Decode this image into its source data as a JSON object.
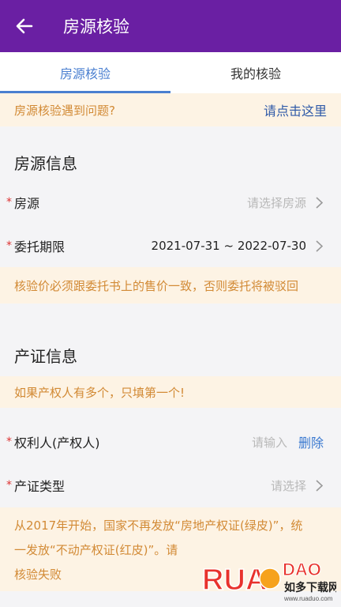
{
  "header": {
    "title": "房源核验",
    "back_icon": "arrow-left-icon"
  },
  "tabs": [
    {
      "label": "房源核验",
      "active": true
    },
    {
      "label": "我的核验",
      "active": false
    }
  ],
  "help_notice": {
    "text": "房源核验遇到问题?",
    "link": "请点击这里"
  },
  "house_section": {
    "title": "房源信息",
    "house": {
      "required": "*",
      "label": "房源",
      "placeholder": "请选择房源"
    },
    "term": {
      "required": "*",
      "label": "委托期限",
      "value": "2021-07-31 ~ 2022-07-30"
    },
    "warning": "核验价必须跟委托书上的售价一致，否则委托将被驳回"
  },
  "cert_section": {
    "title": "产证信息",
    "hint": "如果产权人有多个，只填第一个!",
    "owner": {
      "required": "*",
      "label": "权利人(产权人)",
      "placeholder": "请输入",
      "delete_label": "删除"
    },
    "cert_type": {
      "required": "*",
      "label": "产证类型",
      "placeholder": "请选择"
    },
    "notice_lines": [
      "从2017年开始，国家不再发放“房地产权证(绿皮)”，统",
      "一发放“不动产权证(红皮)”。请",
      "核验失败"
    ]
  },
  "watermark": {
    "brand": "RUAODAO",
    "name": "如多下载网",
    "url": "www.ruaduo.com"
  },
  "colors": {
    "header_bg": "#6a1fa3",
    "accent_blue": "#4a7fd0",
    "notice_bg": "#fdf3e4",
    "notice_text": "#d28a35"
  }
}
